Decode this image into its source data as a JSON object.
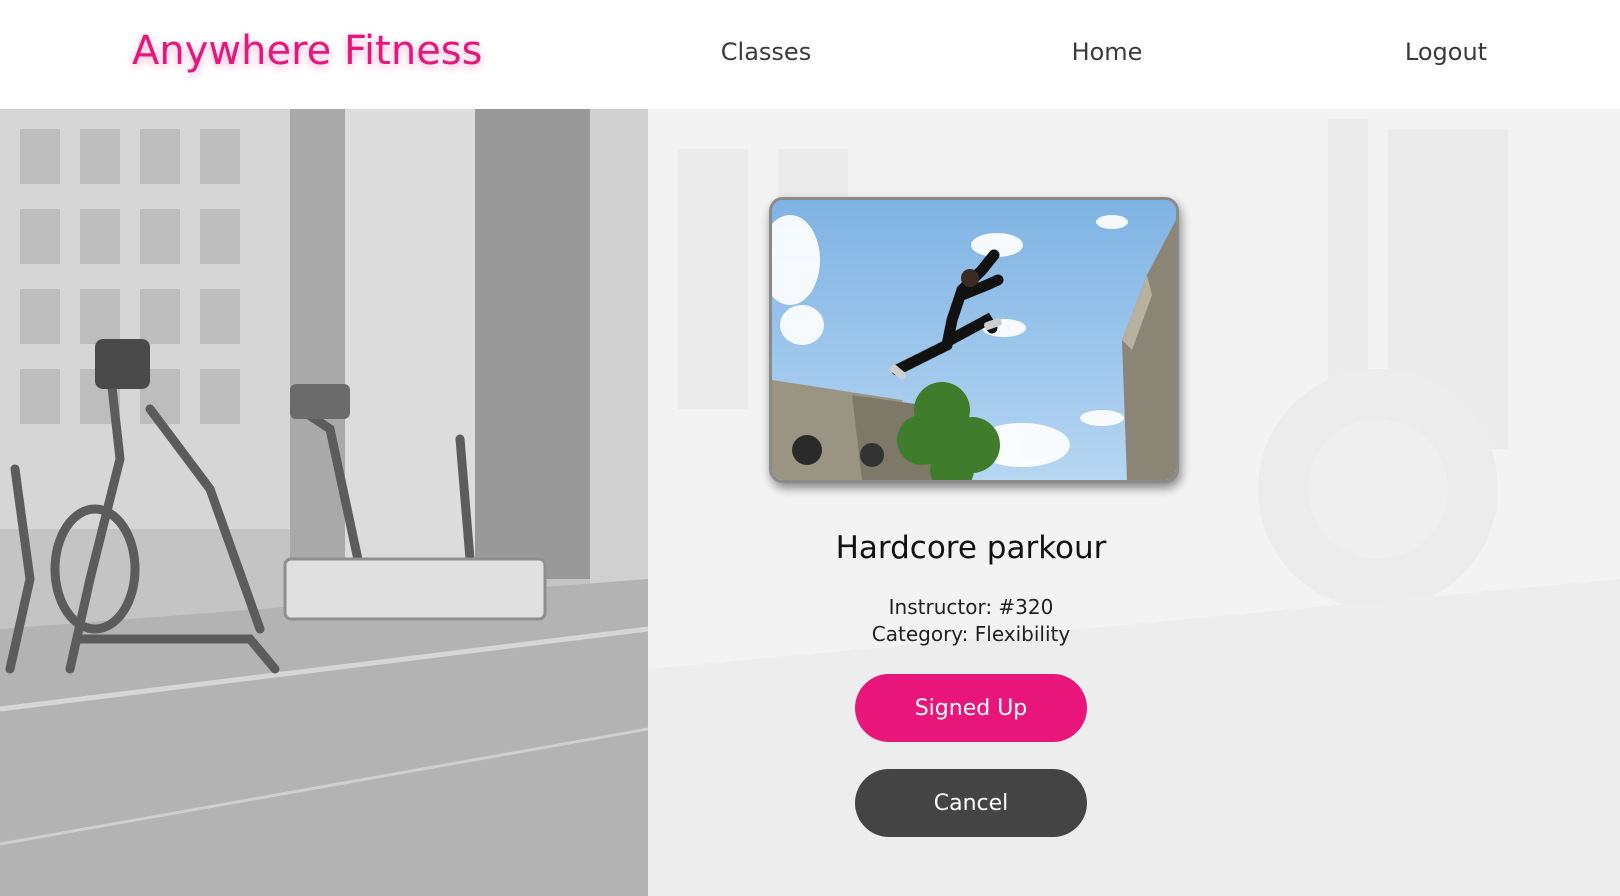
{
  "header": {
    "brand": "Anywhere Fitness",
    "nav": [
      "Classes",
      "Home",
      "Logout"
    ]
  },
  "class_card": {
    "title": "Hardcore parkour",
    "instructor": "Instructor: #320",
    "category": "Category: Flexibility",
    "image_icon": "parkour-photo"
  },
  "actions": {
    "signed_up_label": "Signed Up",
    "cancel_label": "Cancel"
  },
  "colors": {
    "accent": "#e8167b",
    "dark_button": "#444444",
    "nav_text": "#3a3a3a"
  }
}
